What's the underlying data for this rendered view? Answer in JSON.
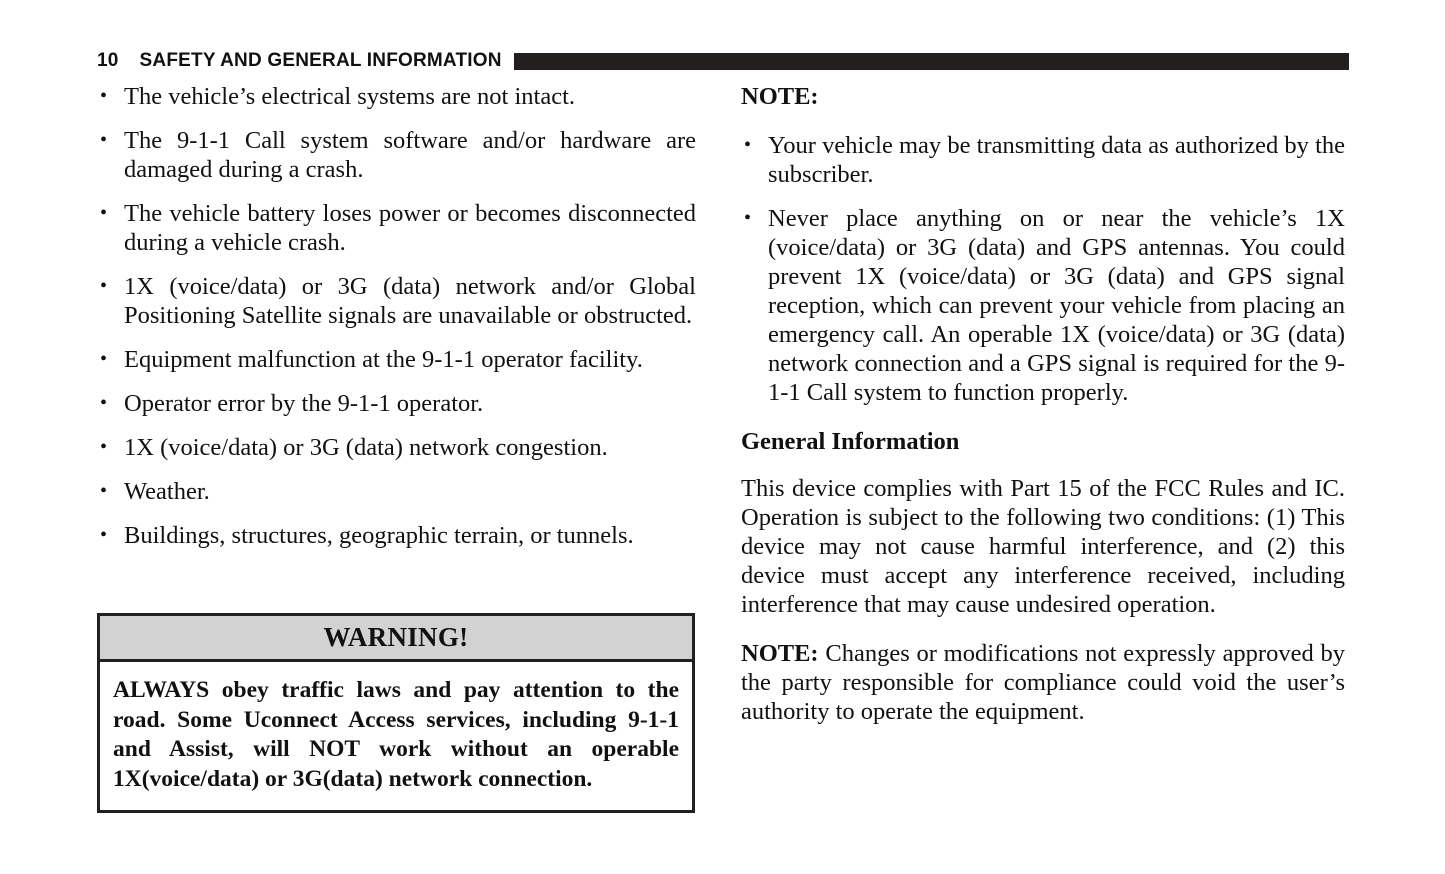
{
  "document": {
    "page_number": "10",
    "header_title": "SAFETY AND GENERAL INFORMATION",
    "header_rule_color": "#231f1e"
  },
  "left_column": {
    "bullets": [
      "The vehicle’s electrical systems are not intact.",
      "The 9-1-1 Call system software and/or hardware are damaged during a crash.",
      "The vehicle battery loses power or becomes disconnected during a vehicle crash.",
      "1X (voice/data) or 3G (data) network and/or Global Positioning Satellite signals are unavailable or obstructed.",
      "Equipment malfunction at the 9-1-1 operator facility.",
      "Operator error by the 9-1-1 operator.",
      "1X (voice/data) or 3G (data) network congestion.",
      "Weather.",
      "Buildings, structures, geographic terrain, or tunnels."
    ],
    "warning": {
      "title": "WARNING!",
      "body": "ALWAYS obey traffic laws and pay attention to the road. Some Uconnect Access services, including 9-1-1 and Assist, will NOT work without an operable 1X(voice/data) or 3G(data) network connection.",
      "title_background": "#d2d2d2",
      "border_color": "#231f1e"
    }
  },
  "right_column": {
    "note_heading": "NOTE:",
    "note_bullets": [
      "Your vehicle may be transmitting data as authorized by the subscriber.",
      "Never place anything on or near the vehicle’s 1X (voice/data) or 3G (data) and GPS antennas. You could prevent 1X (voice/data) or 3G (data) and GPS signal reception, which can prevent your vehicle from placing an emergency call. An operable 1X (voice/data) or 3G (data) network connection and a GPS signal is required for the 9-1-1 Call system to function properly."
    ],
    "general_information": {
      "heading": "General Information",
      "paragraph": "This device complies with Part 15 of the FCC Rules and IC. Operation is subject to the following two conditions: (1) This device may not cause harmful interference, and (2) this device must accept any interference received, including interference that may cause undesired operation."
    },
    "note_paragraph": {
      "label": "NOTE:",
      "text": " Changes or modifications not expressly approved by the party responsible for compliance could void the user’s authority to operate the equipment."
    }
  }
}
